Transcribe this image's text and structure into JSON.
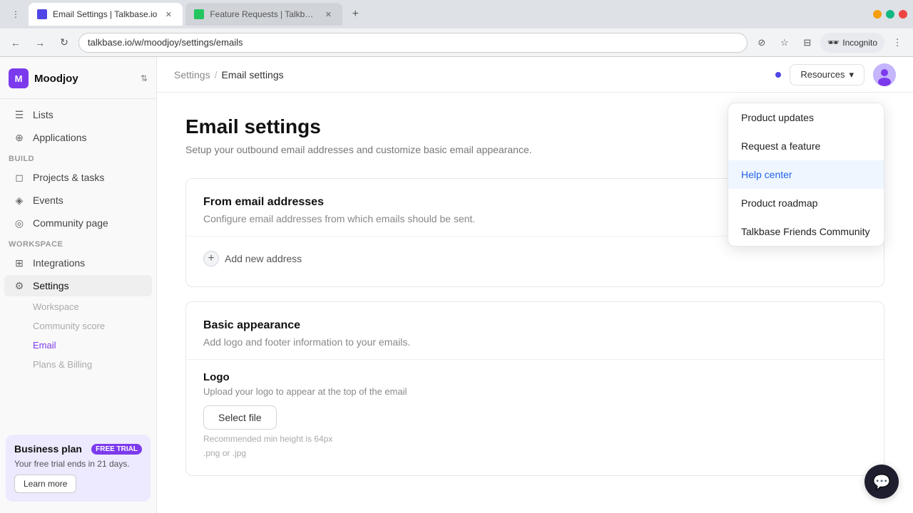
{
  "browser": {
    "tabs": [
      {
        "id": "tab1",
        "title": "Email Settings | Talkbase.io",
        "url": "talkbase.io/w/moodjoy/settings/emails",
        "active": true,
        "favicon_color": "#4f46e5"
      },
      {
        "id": "tab2",
        "title": "Feature Requests | Talkbase",
        "url": "Feature Requests | Talkbase",
        "active": false,
        "favicon_color": "#22c55e"
      }
    ],
    "address": "talkbase.io/w/moodjoy/settings/emails",
    "incognito_label": "Incognito"
  },
  "sidebar": {
    "app_name": "Moodjoy",
    "logo_letter": "M",
    "items": [
      {
        "id": "lists",
        "label": "Lists",
        "icon": "☰"
      },
      {
        "id": "applications",
        "label": "Applications",
        "icon": "⊕"
      }
    ],
    "build_section": "BUILD",
    "build_items": [
      {
        "id": "projects",
        "label": "Projects & tasks",
        "icon": "◻"
      },
      {
        "id": "events",
        "label": "Events",
        "icon": "◈"
      },
      {
        "id": "community",
        "label": "Community page",
        "icon": "◎"
      }
    ],
    "workspace_section": "WORKSPACE",
    "workspace_items": [
      {
        "id": "integrations",
        "label": "Integrations",
        "icon": "⊞"
      },
      {
        "id": "settings",
        "label": "Settings",
        "icon": "⚙"
      }
    ],
    "settings_sub_items": [
      {
        "id": "workspace",
        "label": "Workspace",
        "active": false,
        "muted": false
      },
      {
        "id": "community_score",
        "label": "Community score",
        "active": false,
        "muted": false
      },
      {
        "id": "email",
        "label": "Email",
        "active": true,
        "muted": false
      },
      {
        "id": "plans_billing",
        "label": "Plans & Billing",
        "active": false,
        "muted": true
      }
    ]
  },
  "banner": {
    "title": "Business plan",
    "badge": "FREE TRIAL",
    "text": "Your free trial ends in 21 days.",
    "button_label": "Learn more"
  },
  "header": {
    "breadcrumb_settings": "Settings",
    "breadcrumb_sep": "/",
    "breadcrumb_current": "Email settings",
    "resources_label": "Resources",
    "resources_chevron": "▾"
  },
  "page": {
    "title": "Email settings",
    "subtitle": "Setup your outbound email addresses and customize basic email appearance.",
    "from_section": {
      "title": "From email addresses",
      "description": "Configure email addresses from which emails should be sent.",
      "add_label": "Add new address"
    },
    "appearance_section": {
      "title": "Basic appearance",
      "description": "Add logo and footer information to your emails."
    },
    "logo_section": {
      "title": "Logo",
      "description": "Upload your logo to appear at the top of the email",
      "button_label": "Select file",
      "hint_line1": "Recommended min height is 64px",
      "hint_line2": ".png or .jpg"
    }
  },
  "resources_dropdown": {
    "items": [
      {
        "id": "product_updates",
        "label": "Product updates",
        "highlighted": false
      },
      {
        "id": "request_feature",
        "label": "Request a feature",
        "highlighted": false
      },
      {
        "id": "help_center",
        "label": "Help center",
        "highlighted": true
      },
      {
        "id": "product_roadmap",
        "label": "Product roadmap",
        "highlighted": false
      },
      {
        "id": "community",
        "label": "Talkbase Friends Community",
        "highlighted": false
      }
    ]
  }
}
